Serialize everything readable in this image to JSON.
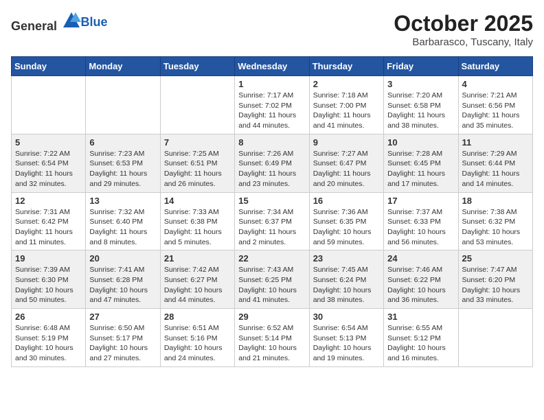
{
  "header": {
    "logo_general": "General",
    "logo_blue": "Blue",
    "month": "October 2025",
    "location": "Barbarasco, Tuscany, Italy"
  },
  "weekdays": [
    "Sunday",
    "Monday",
    "Tuesday",
    "Wednesday",
    "Thursday",
    "Friday",
    "Saturday"
  ],
  "weeks": [
    [
      {
        "day": "",
        "info": ""
      },
      {
        "day": "",
        "info": ""
      },
      {
        "day": "",
        "info": ""
      },
      {
        "day": "1",
        "info": "Sunrise: 7:17 AM\nSunset: 7:02 PM\nDaylight: 11 hours and 44 minutes."
      },
      {
        "day": "2",
        "info": "Sunrise: 7:18 AM\nSunset: 7:00 PM\nDaylight: 11 hours and 41 minutes."
      },
      {
        "day": "3",
        "info": "Sunrise: 7:20 AM\nSunset: 6:58 PM\nDaylight: 11 hours and 38 minutes."
      },
      {
        "day": "4",
        "info": "Sunrise: 7:21 AM\nSunset: 6:56 PM\nDaylight: 11 hours and 35 minutes."
      }
    ],
    [
      {
        "day": "5",
        "info": "Sunrise: 7:22 AM\nSunset: 6:54 PM\nDaylight: 11 hours and 32 minutes."
      },
      {
        "day": "6",
        "info": "Sunrise: 7:23 AM\nSunset: 6:53 PM\nDaylight: 11 hours and 29 minutes."
      },
      {
        "day": "7",
        "info": "Sunrise: 7:25 AM\nSunset: 6:51 PM\nDaylight: 11 hours and 26 minutes."
      },
      {
        "day": "8",
        "info": "Sunrise: 7:26 AM\nSunset: 6:49 PM\nDaylight: 11 hours and 23 minutes."
      },
      {
        "day": "9",
        "info": "Sunrise: 7:27 AM\nSunset: 6:47 PM\nDaylight: 11 hours and 20 minutes."
      },
      {
        "day": "10",
        "info": "Sunrise: 7:28 AM\nSunset: 6:45 PM\nDaylight: 11 hours and 17 minutes."
      },
      {
        "day": "11",
        "info": "Sunrise: 7:29 AM\nSunset: 6:44 PM\nDaylight: 11 hours and 14 minutes."
      }
    ],
    [
      {
        "day": "12",
        "info": "Sunrise: 7:31 AM\nSunset: 6:42 PM\nDaylight: 11 hours and 11 minutes."
      },
      {
        "day": "13",
        "info": "Sunrise: 7:32 AM\nSunset: 6:40 PM\nDaylight: 11 hours and 8 minutes."
      },
      {
        "day": "14",
        "info": "Sunrise: 7:33 AM\nSunset: 6:38 PM\nDaylight: 11 hours and 5 minutes."
      },
      {
        "day": "15",
        "info": "Sunrise: 7:34 AM\nSunset: 6:37 PM\nDaylight: 11 hours and 2 minutes."
      },
      {
        "day": "16",
        "info": "Sunrise: 7:36 AM\nSunset: 6:35 PM\nDaylight: 10 hours and 59 minutes."
      },
      {
        "day": "17",
        "info": "Sunrise: 7:37 AM\nSunset: 6:33 PM\nDaylight: 10 hours and 56 minutes."
      },
      {
        "day": "18",
        "info": "Sunrise: 7:38 AM\nSunset: 6:32 PM\nDaylight: 10 hours and 53 minutes."
      }
    ],
    [
      {
        "day": "19",
        "info": "Sunrise: 7:39 AM\nSunset: 6:30 PM\nDaylight: 10 hours and 50 minutes."
      },
      {
        "day": "20",
        "info": "Sunrise: 7:41 AM\nSunset: 6:28 PM\nDaylight: 10 hours and 47 minutes."
      },
      {
        "day": "21",
        "info": "Sunrise: 7:42 AM\nSunset: 6:27 PM\nDaylight: 10 hours and 44 minutes."
      },
      {
        "day": "22",
        "info": "Sunrise: 7:43 AM\nSunset: 6:25 PM\nDaylight: 10 hours and 41 minutes."
      },
      {
        "day": "23",
        "info": "Sunrise: 7:45 AM\nSunset: 6:24 PM\nDaylight: 10 hours and 38 minutes."
      },
      {
        "day": "24",
        "info": "Sunrise: 7:46 AM\nSunset: 6:22 PM\nDaylight: 10 hours and 36 minutes."
      },
      {
        "day": "25",
        "info": "Sunrise: 7:47 AM\nSunset: 6:20 PM\nDaylight: 10 hours and 33 minutes."
      }
    ],
    [
      {
        "day": "26",
        "info": "Sunrise: 6:48 AM\nSunset: 5:19 PM\nDaylight: 10 hours and 30 minutes."
      },
      {
        "day": "27",
        "info": "Sunrise: 6:50 AM\nSunset: 5:17 PM\nDaylight: 10 hours and 27 minutes."
      },
      {
        "day": "28",
        "info": "Sunrise: 6:51 AM\nSunset: 5:16 PM\nDaylight: 10 hours and 24 minutes."
      },
      {
        "day": "29",
        "info": "Sunrise: 6:52 AM\nSunset: 5:14 PM\nDaylight: 10 hours and 21 minutes."
      },
      {
        "day": "30",
        "info": "Sunrise: 6:54 AM\nSunset: 5:13 PM\nDaylight: 10 hours and 19 minutes."
      },
      {
        "day": "31",
        "info": "Sunrise: 6:55 AM\nSunset: 5:12 PM\nDaylight: 10 hours and 16 minutes."
      },
      {
        "day": "",
        "info": ""
      }
    ]
  ]
}
